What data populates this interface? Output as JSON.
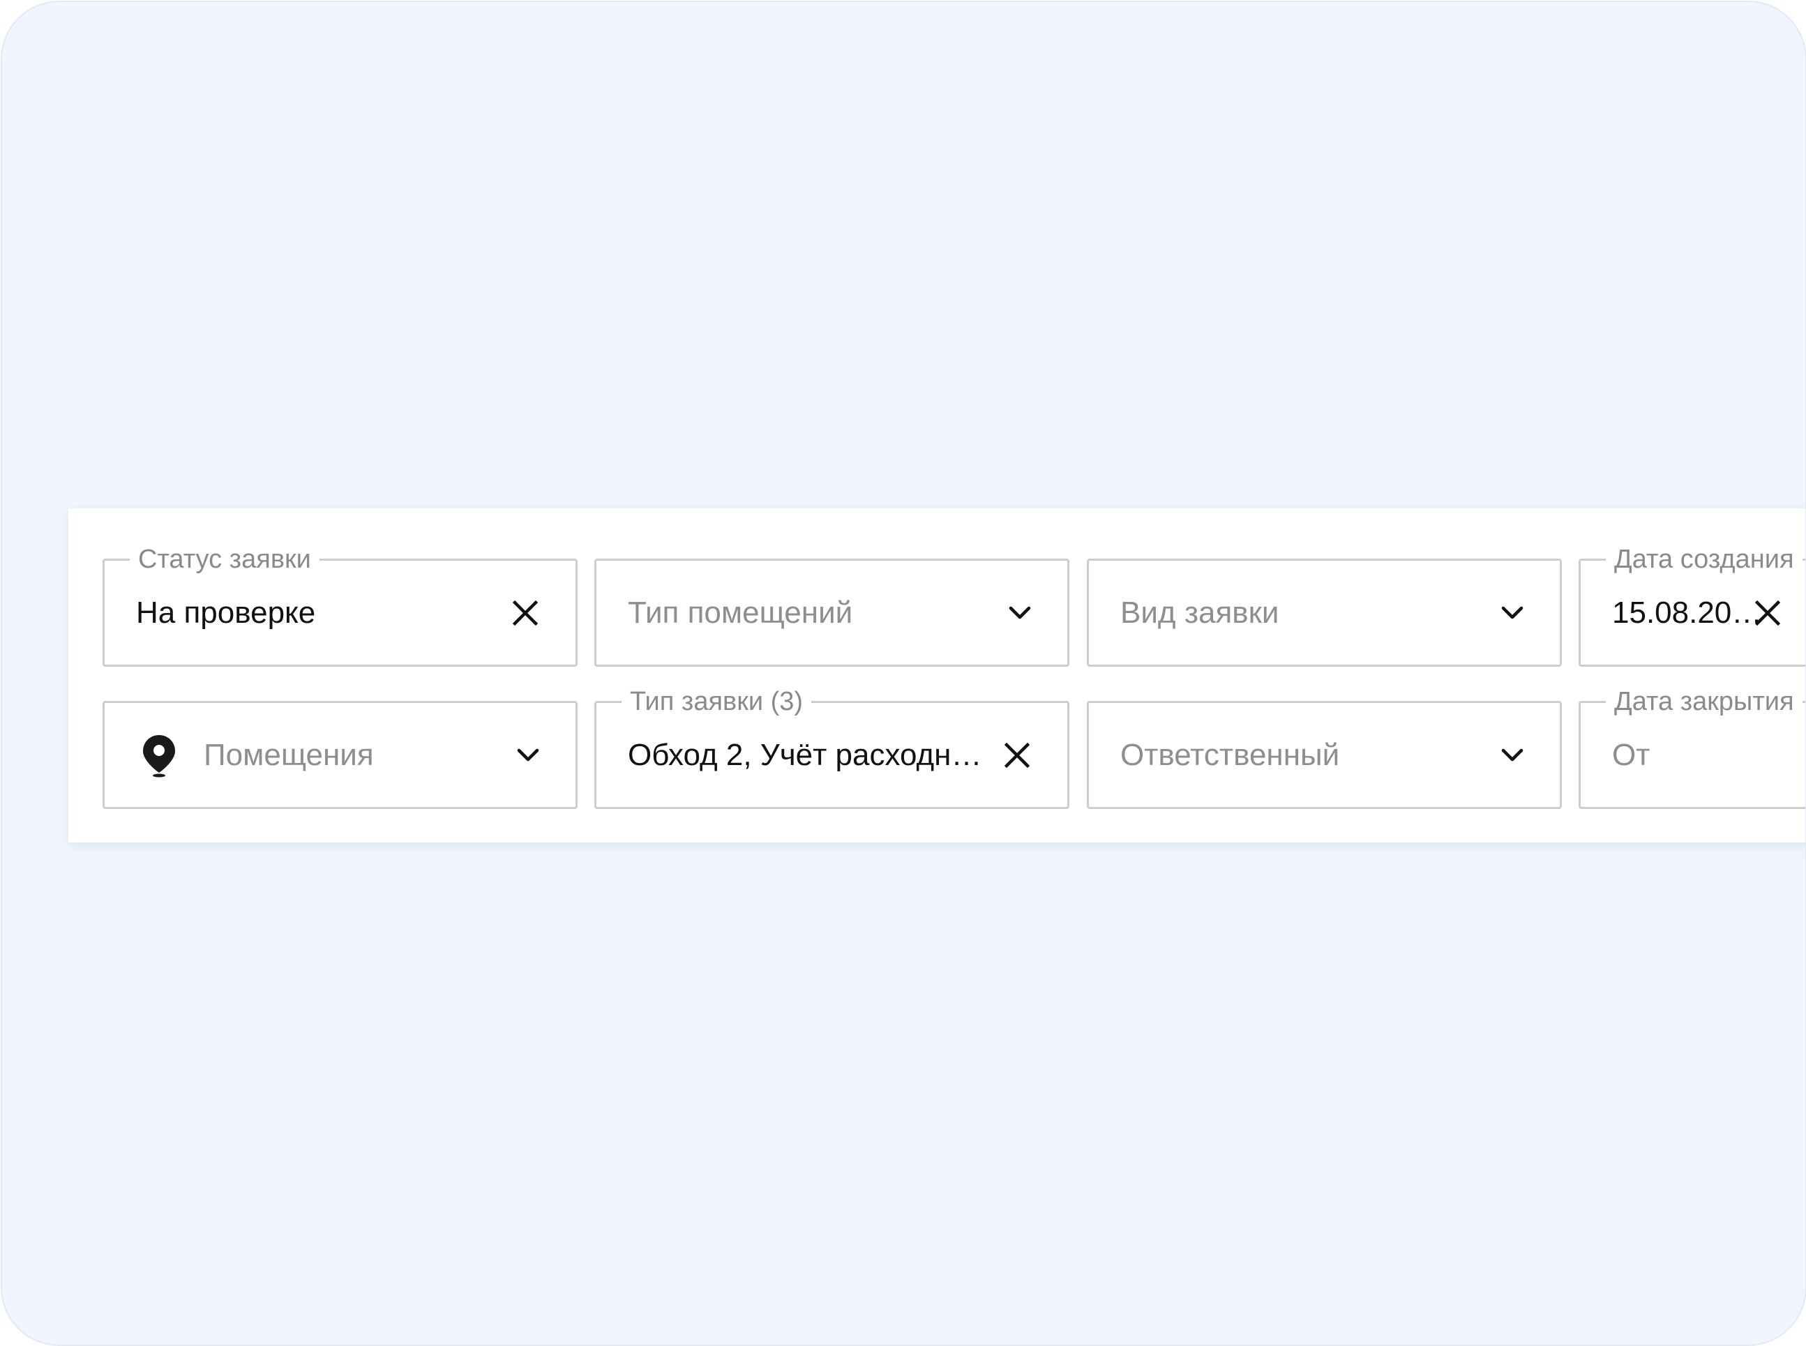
{
  "filters": {
    "status": {
      "label": "Статус заявки",
      "value": "На проверке",
      "clear_icon": "close-icon"
    },
    "room_type": {
      "placeholder": "Тип помещений",
      "dropdown_icon": "chevron-down-icon"
    },
    "request_kind": {
      "placeholder": "Вид заявки",
      "dropdown_icon": "chevron-down-icon"
    },
    "created_date": {
      "label": "Дата создания",
      "value": "15.08.20…",
      "clear_icon": "close-icon"
    },
    "rooms": {
      "placeholder": "Помещения",
      "leading_icon": "location-pin-icon",
      "dropdown_icon": "chevron-down-icon"
    },
    "request_type": {
      "label": "Тип заявки (3)",
      "value": "Обход 2, Учёт расходн…",
      "clear_icon": "close-icon"
    },
    "responsible": {
      "placeholder": "Ответственный",
      "dropdown_icon": "chevron-down-icon"
    },
    "closed_date": {
      "label": "Дата закрытия",
      "placeholder": "От"
    }
  },
  "colors": {
    "background": "#f1f6fe",
    "panel": "#ffffff",
    "border": "#cdcdcd",
    "label": "#8a8a8a",
    "text": "#111111"
  }
}
